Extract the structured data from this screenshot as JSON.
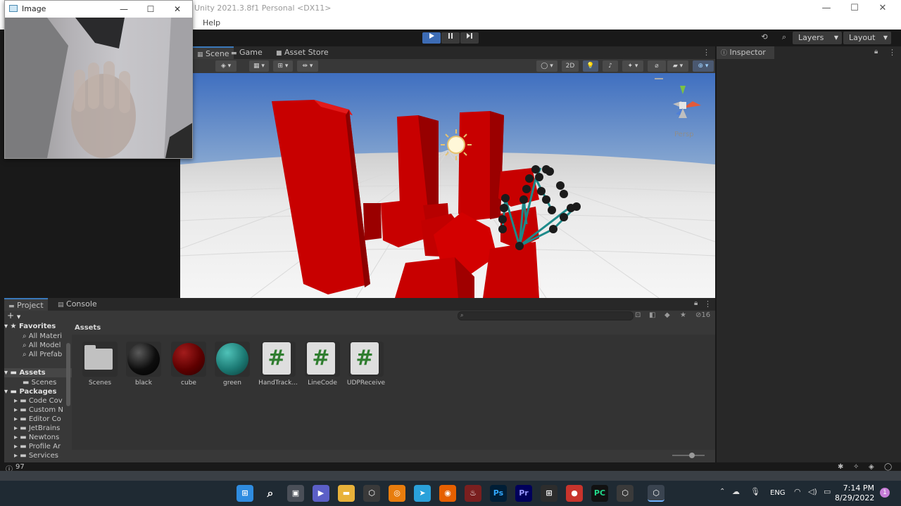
{
  "window": {
    "title": "Unity 2021.3.8f1 Personal <DX11>",
    "menu_help": "Help",
    "min_glyph": "—",
    "max_glyph": "☐",
    "close_glyph": "✕"
  },
  "toolbar": {
    "layers_label": "Layers",
    "layout_label": "Layout"
  },
  "scene_panel": {
    "tabs": [
      {
        "label": "Scene",
        "icon": "grid-icon"
      },
      {
        "label": "Game",
        "icon": "gamepad-icon"
      },
      {
        "label": "Asset Store",
        "icon": "store-bag-icon"
      }
    ],
    "mode_2d": "2D",
    "gizmo_label": "Persp"
  },
  "inspector": {
    "tab_label": "Inspector"
  },
  "project_panel": {
    "tabs": [
      {
        "label": "Project",
        "icon": "folder-icon"
      },
      {
        "label": "Console",
        "icon": "console-icon"
      }
    ],
    "add_label": "+",
    "search_placeholder": "",
    "visible_count": "16",
    "breadcrumb": "Assets",
    "tree": {
      "favorites_label": "Favorites",
      "favorites": [
        "All Materi",
        "All Model",
        "All Prefab"
      ],
      "assets_label": "Assets",
      "assets_children": [
        "Scenes"
      ],
      "packages_label": "Packages",
      "packages": [
        "Code Cov",
        "Custom N",
        "Editor Co",
        "JetBrains",
        "Newtons",
        "Profile Ar",
        "Services"
      ]
    },
    "items": [
      {
        "label": "Scenes",
        "kind": "folder"
      },
      {
        "label": "black",
        "kind": "material",
        "color": "#0d0d0d"
      },
      {
        "label": "cube",
        "kind": "material",
        "color": "#5e0000"
      },
      {
        "label": "green",
        "kind": "material",
        "color": "#1c7a74"
      },
      {
        "label": "HandTrack...",
        "kind": "script"
      },
      {
        "label": "LineCode",
        "kind": "script"
      },
      {
        "label": "UDPReceive",
        "kind": "script"
      }
    ]
  },
  "status": {
    "message": "97"
  },
  "webcam_window": {
    "title": "Image"
  },
  "taskbar": {
    "language": "ENG",
    "time": "7:14 PM",
    "date": "8/29/2022",
    "notification_count": "1",
    "apps": [
      "windows-start",
      "search",
      "file-explorer-task",
      "teams",
      "explorer",
      "unity-hub",
      "blender",
      "telegram",
      "firefox",
      "popcorn",
      "photoshop",
      "premiere",
      "store",
      "recorder",
      "pycharm",
      "unity",
      "unity-editor"
    ]
  },
  "colors": {
    "accent": "#3a79bb",
    "play_active": "#3d6cb5",
    "cube_red": "#c80000",
    "joint_line": "#1d8a8a"
  }
}
